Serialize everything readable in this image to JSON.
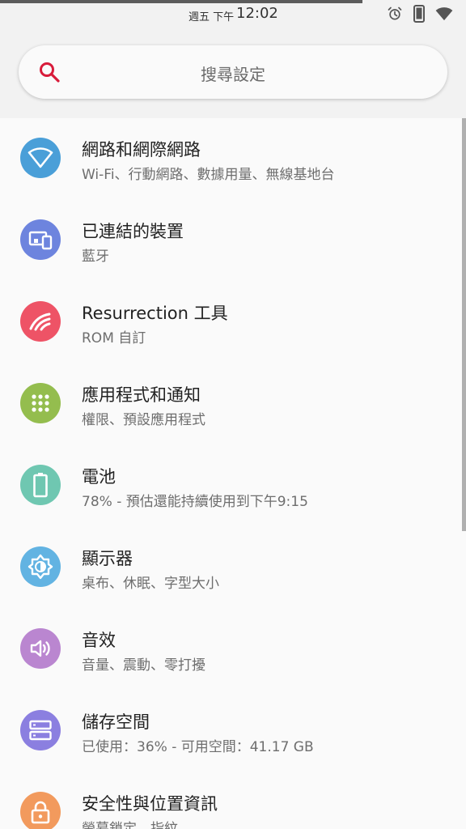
{
  "status_bar": {
    "day": "週五 下午",
    "time": "12:02",
    "icons": [
      "alarm-icon",
      "phone-icon",
      "wifi-icon"
    ]
  },
  "search": {
    "placeholder": "搜尋設定",
    "icon": "search-icon"
  },
  "settings": [
    {
      "id": "network",
      "title": "網路和網際網路",
      "subtitle": "Wi-Fi、行動網路、數據用量、無線基地台",
      "icon": "wifi-icon",
      "color": "#4a9fd8"
    },
    {
      "id": "connected-devices",
      "title": "已連結的裝置",
      "subtitle": "藍牙",
      "icon": "devices-icon",
      "color": "#6d84de"
    },
    {
      "id": "resurrection",
      "title": "Resurrection 工具",
      "subtitle": "ROM 自訂",
      "icon": "resurrection-logo-icon",
      "color": "#ee5366"
    },
    {
      "id": "apps",
      "title": "應用程式和通知",
      "subtitle": "權限、預設應用程式",
      "icon": "apps-grid-icon",
      "color": "#94bd4e"
    },
    {
      "id": "battery",
      "title": "電池",
      "subtitle": "78% - 預估還能持續使用到下午9:15",
      "icon": "battery-icon",
      "color": "#6fc7b1"
    },
    {
      "id": "display",
      "title": "顯示器",
      "subtitle": "桌布、休眠、字型大小",
      "icon": "brightness-icon",
      "color": "#62b3e2"
    },
    {
      "id": "sound",
      "title": "音效",
      "subtitle": "音量、震動、零打擾",
      "icon": "volume-icon",
      "color": "#ba86d0"
    },
    {
      "id": "storage",
      "title": "儲存空間",
      "subtitle": "已使用：36% - 可用空間：41.17 GB",
      "icon": "storage-icon",
      "color": "#8b7fe0"
    },
    {
      "id": "security",
      "title": "安全性與位置資訊",
      "subtitle": "螢幕鎖定、指紋",
      "icon": "lock-icon",
      "color": "#f29a5d"
    }
  ]
}
